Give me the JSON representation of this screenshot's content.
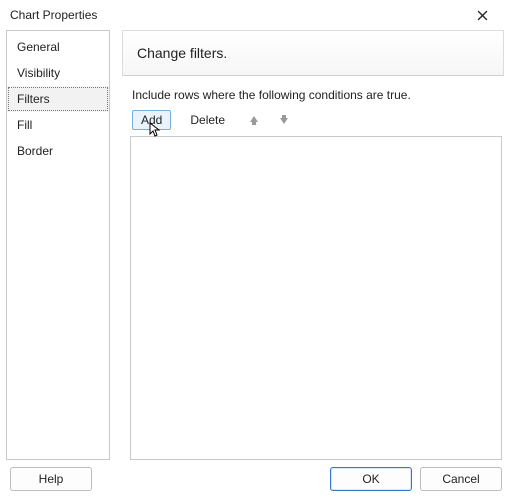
{
  "window": {
    "title": "Chart Properties"
  },
  "sidebar": {
    "items": [
      {
        "label": "General",
        "selected": false
      },
      {
        "label": "Visibility",
        "selected": false
      },
      {
        "label": "Filters",
        "selected": true
      },
      {
        "label": "Fill",
        "selected": false
      },
      {
        "label": "Border",
        "selected": false
      }
    ]
  },
  "main": {
    "heading": "Change filters.",
    "instruction": "Include rows where the following conditions are true.",
    "toolbar": {
      "add_label": "Add",
      "delete_label": "Delete"
    }
  },
  "footer": {
    "help_label": "Help",
    "ok_label": "OK",
    "cancel_label": "Cancel"
  }
}
